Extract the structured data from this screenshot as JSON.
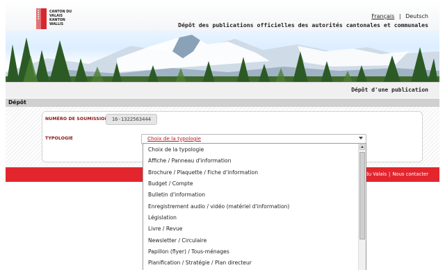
{
  "header": {
    "logo_line1": "CANTON DU VALAIS",
    "logo_line2": "KANTON WALLIS",
    "lang_fr": "Français",
    "lang_sep": "|",
    "lang_de": "Deutsch",
    "site_title": "Dépôt des publications officielles des autorités cantonales et communales"
  },
  "section_title": "Dépôt d'une publication",
  "breadcrumb": "Dépôt",
  "form": {
    "submission_label": "NUMÉRO DE SOUMISSION",
    "submission_value": "16-1322563444",
    "typology_label": "TYPOLOGIE",
    "typology_selected": "Choix de la typologie"
  },
  "footer": {
    "link1": "at du Valais",
    "sep": "|",
    "link2": "Nous contacter"
  },
  "dropdown": {
    "options": [
      "Choix de la typologie",
      "Affiche / Panneau d'information",
      "Brochure / Plaquette / Fiche d'information",
      "Budget / Compte",
      "Bulletin d'information",
      "Enregistrement audio / vidéo (matériel d'information)",
      "Législation",
      "Livre / Revue",
      "Newsletter / Circulaire",
      "Papillon (flyer) / Tous-ménages",
      "Planification / Stratégie / Plan directeur"
    ]
  },
  "colors": {
    "brand_red": "#e3262e",
    "label_red": "#8a1010"
  },
  "icons": {
    "logo": "valais-flag-icon",
    "select_arrow": "chevron-down-icon",
    "scroll_up": "scroll-up-arrow-icon"
  }
}
